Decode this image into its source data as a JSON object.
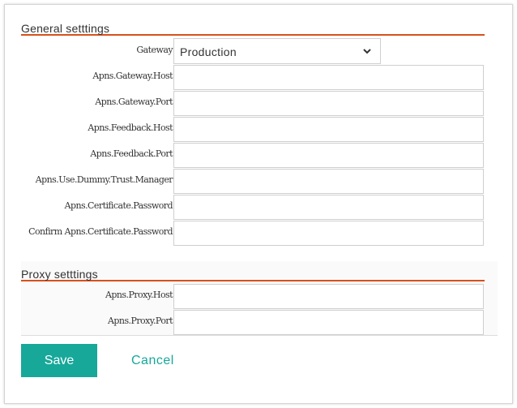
{
  "general": {
    "title": "General setttings",
    "gateway": {
      "label": "Gateway",
      "selected": "Production"
    },
    "fields": [
      {
        "label": "Apns.Gateway.Host",
        "value": ""
      },
      {
        "label": "Apns.Gateway.Port",
        "value": ""
      },
      {
        "label": "Apns.Feedback.Host",
        "value": ""
      },
      {
        "label": "Apns.Feedback.Port",
        "value": ""
      },
      {
        "label": "Apns.Use.Dummy.Trust.Manager",
        "value": ""
      },
      {
        "label": "Apns.Certificate.Password",
        "value": ""
      },
      {
        "label": "Confirm Apns.Certificate.Password",
        "value": ""
      }
    ]
  },
  "proxy": {
    "title": "Proxy setttings",
    "fields": [
      {
        "label": "Apns.Proxy.Host",
        "value": ""
      },
      {
        "label": "Apns.Proxy.Port",
        "value": ""
      }
    ]
  },
  "actions": {
    "save_label": "Save",
    "cancel_label": "Cancel"
  },
  "colors": {
    "accent": "#d8501e",
    "primary": "#17a89a"
  },
  "icons": {
    "dropdown": "chevron-down-icon"
  }
}
